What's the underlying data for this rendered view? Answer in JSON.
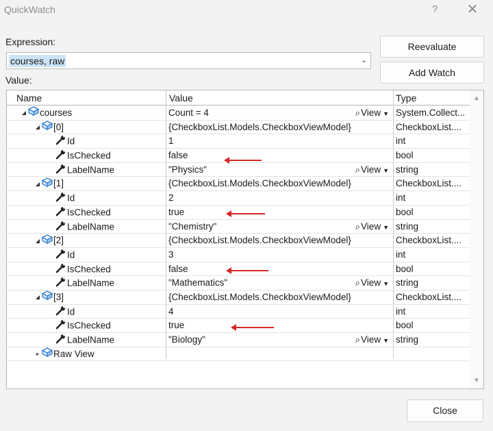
{
  "window": {
    "title": "QuickWatch",
    "help_glyph": "?",
    "close_glyph": "✕"
  },
  "expression": {
    "label": "Expression:",
    "value": "courses, raw"
  },
  "value_label": "Value:",
  "buttons": {
    "reevaluate": "Reevaluate",
    "add_watch": "Add Watch",
    "close": "Close"
  },
  "grid": {
    "columns": [
      "Name",
      "Value",
      "Type"
    ],
    "view_label": "View",
    "rows": [
      {
        "depth": 0,
        "expander": "◢",
        "icon": "object",
        "name": "courses",
        "value": "Count = 4",
        "view": true,
        "type": "System.Collect..."
      },
      {
        "depth": 1,
        "expander": "◢",
        "icon": "object",
        "name": "[0]",
        "value": "{CheckboxList.Models.CheckboxViewModel}",
        "view": false,
        "type": "CheckboxList...."
      },
      {
        "depth": 2,
        "expander": "",
        "icon": "wrench",
        "name": "Id",
        "value": "1",
        "view": false,
        "type": "int"
      },
      {
        "depth": 2,
        "expander": "",
        "icon": "wrench",
        "name": "IsChecked",
        "value": "false",
        "view": false,
        "type": "bool"
      },
      {
        "depth": 2,
        "expander": "",
        "icon": "wrench",
        "name": "LabelName",
        "value": "\"Physics\"",
        "view": true,
        "type": "string"
      },
      {
        "depth": 1,
        "expander": "◢",
        "icon": "object",
        "name": "[1]",
        "value": "{CheckboxList.Models.CheckboxViewModel}",
        "view": false,
        "type": "CheckboxList...."
      },
      {
        "depth": 2,
        "expander": "",
        "icon": "wrench",
        "name": "Id",
        "value": "2",
        "view": false,
        "type": "int"
      },
      {
        "depth": 2,
        "expander": "",
        "icon": "wrench",
        "name": "IsChecked",
        "value": "true",
        "view": false,
        "type": "bool"
      },
      {
        "depth": 2,
        "expander": "",
        "icon": "wrench",
        "name": "LabelName",
        "value": "\"Chemistry\"",
        "view": true,
        "type": "string"
      },
      {
        "depth": 1,
        "expander": "◢",
        "icon": "object",
        "name": "[2]",
        "value": "{CheckboxList.Models.CheckboxViewModel}",
        "view": false,
        "type": "CheckboxList...."
      },
      {
        "depth": 2,
        "expander": "",
        "icon": "wrench",
        "name": "Id",
        "value": "3",
        "view": false,
        "type": "int"
      },
      {
        "depth": 2,
        "expander": "",
        "icon": "wrench",
        "name": "IsChecked",
        "value": "false",
        "view": false,
        "type": "bool"
      },
      {
        "depth": 2,
        "expander": "",
        "icon": "wrench",
        "name": "LabelName",
        "value": "\"Mathematics\"",
        "view": true,
        "type": "string"
      },
      {
        "depth": 1,
        "expander": "◢",
        "icon": "object",
        "name": "[3]",
        "value": "{CheckboxList.Models.CheckboxViewModel}",
        "view": false,
        "type": "CheckboxList...."
      },
      {
        "depth": 2,
        "expander": "",
        "icon": "wrench",
        "name": "Id",
        "value": "4",
        "view": false,
        "type": "int"
      },
      {
        "depth": 2,
        "expander": "",
        "icon": "wrench",
        "name": "IsChecked",
        "value": "true",
        "view": false,
        "type": "bool"
      },
      {
        "depth": 2,
        "expander": "",
        "icon": "wrench",
        "name": "LabelName",
        "value": "\"Biology\"",
        "view": true,
        "type": "string"
      },
      {
        "depth": 1,
        "expander": "▸",
        "icon": "object",
        "name": "Raw View",
        "value": "",
        "view": false,
        "type": ""
      }
    ]
  },
  "annotations": {
    "highlighted_rows": [
      "IsChecked"
    ],
    "arrow_color": "#d62828"
  }
}
